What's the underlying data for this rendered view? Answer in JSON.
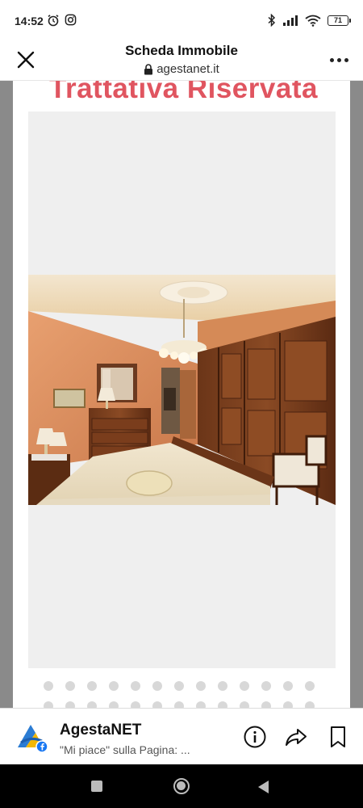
{
  "status_bar": {
    "time": "14:52",
    "battery": "71",
    "icons": [
      "alarm-icon",
      "instagram-icon",
      "bluetooth-icon",
      "signal-icon",
      "wifi-icon",
      "battery-icon"
    ]
  },
  "browser": {
    "title": "Scheda Immobile",
    "url": "agestanet.it",
    "close_icon": "close-icon",
    "lock_icon": "lock-icon",
    "menu_icon": "more-vert-icon"
  },
  "listing": {
    "headline": "Trattativa Riservata",
    "photo_subject": "bedroom-photo",
    "carousel_dots_row1": 13,
    "carousel_dots_row2": 13
  },
  "banner": {
    "brand_name": "AgestaNET",
    "subtitle": "\"Mi piace\" sulla Pagina: ...",
    "icons": [
      "info-icon",
      "share-icon",
      "bookmark-icon"
    ]
  },
  "colors": {
    "headline": "#e05560",
    "page_bg": "#8a8a8a",
    "gallery_bg": "#efefef"
  }
}
